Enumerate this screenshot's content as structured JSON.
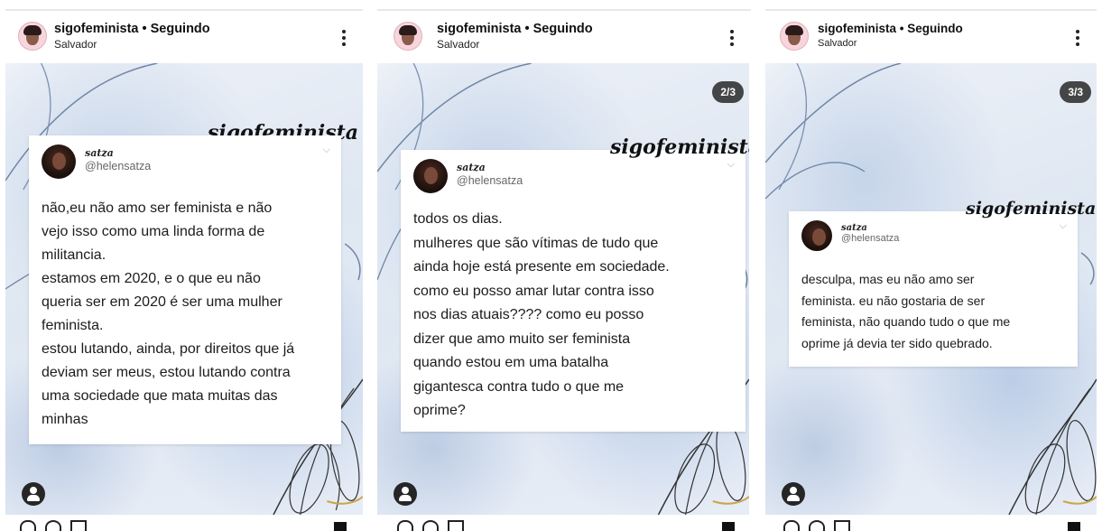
{
  "panels": [
    {
      "handle": "sigofeminista • Seguindo",
      "location": "Salvador",
      "counter": "",
      "brand": "sigofeminista",
      "card": {
        "name": "satza",
        "username": "@helensatza",
        "text": "não,eu não amo ser feminista e não\nvejo isso como uma linda forma de\nmilitancia.\nestamos em 2020, e o que eu não\nqueria ser em 2020 é ser uma mulher\nfeminista.\nestou lutando, ainda, por direitos que já\ndeviam ser meus, estou lutando contra\numa sociedade que mata muitas das\nminhas"
      }
    },
    {
      "handle": "sigofeminista • Seguindo",
      "location": "Salvador",
      "counter": "2/3",
      "brand": "sigofeminista",
      "card": {
        "name": "satza",
        "username": "@helensatza",
        "text": "todos os dias.\nmulheres que são vítimas de tudo que\nainda hoje está presente em sociedade.\ncomo eu posso amar lutar contra isso\nnos dias atuais???? como eu posso\ndizer que amo muito ser feminista\nquando estou em uma batalha\ngigantesca contra tudo o que me\noprime?"
      }
    },
    {
      "handle": "sigofeminista • Seguindo",
      "location": "Salvador",
      "counter": "3/3",
      "brand": "sigofeminista",
      "card": {
        "name": "satza",
        "username": "@helensatza",
        "text": "desculpa, mas eu não amo ser\nfeminista. eu não gostaria de ser\nfeminista, não quando tudo o que me\noprime já devia ter sido quebrado."
      }
    }
  ],
  "icons": {
    "more": "more-options-icon",
    "user_tag": "user-tag-icon",
    "like": "heart-icon",
    "comment": "comment-icon",
    "share": "share-icon",
    "save": "bookmark-icon"
  },
  "colors": {
    "background_tint": "#dfe7f2",
    "counter_badge": "#2a2a2a",
    "text": "#1c1c1c"
  }
}
